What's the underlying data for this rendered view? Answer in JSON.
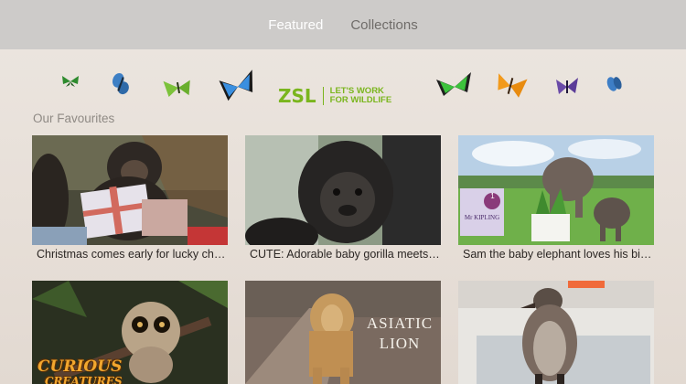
{
  "tabs": [
    {
      "label": "Featured",
      "active": true
    },
    {
      "label": "Collections",
      "active": false
    }
  ],
  "banner": {
    "logo_mark": "ZSL",
    "tagline_1": "LET'S WORK",
    "tagline_2": "FOR WILDLIFE",
    "brand_color": "#7ab51d"
  },
  "section": {
    "title": "Our Favourites"
  },
  "videos": [
    {
      "caption": "Christmas comes early for lucky chimps",
      "thumb": "chimp-with-gift"
    },
    {
      "caption": "CUTE: Adorable baby gorilla meets his family",
      "thumb": "baby-gorilla"
    },
    {
      "caption": "Sam the baby elephant loves his birthday cake",
      "thumb": "elephants-cake"
    },
    {
      "caption": "",
      "thumb": "slow-loris",
      "overlay_1": "CURIOUS",
      "overlay_2": "CREATURES"
    },
    {
      "caption": "",
      "thumb": "asiatic-lion",
      "overlay_1": "ASIATIC",
      "overlay_2": "LION"
    },
    {
      "caption": "",
      "thumb": "penguin-chick"
    }
  ],
  "elephant_sign": {
    "number": "1",
    "brand": "Mr KIPLING"
  }
}
